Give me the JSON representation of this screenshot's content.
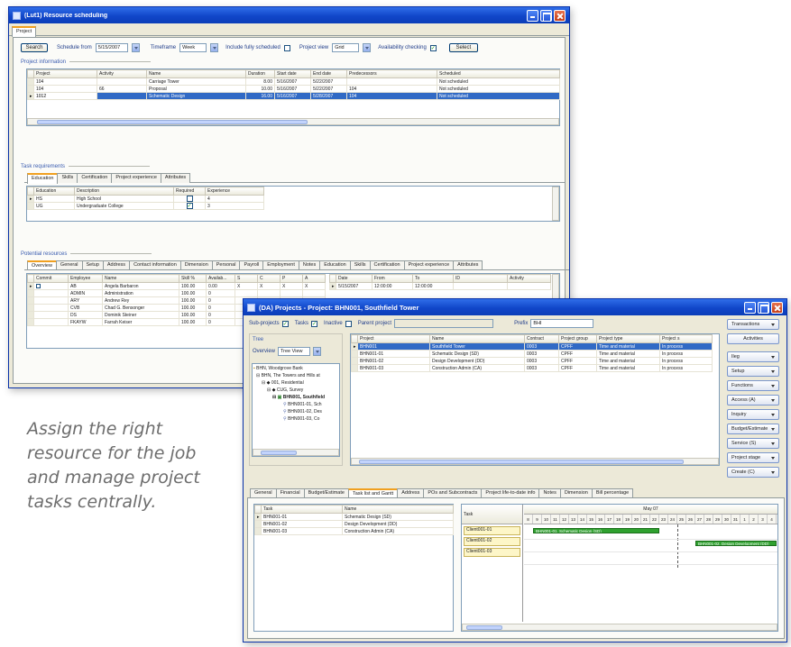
{
  "caption": {
    "line1": "Assign the right",
    "line2": "resource for the job",
    "line3": "and manage project",
    "line4": "tasks centrally."
  },
  "window1": {
    "title": "(Lut1) Resource scheduling",
    "main_tab": "Project",
    "toolbar": {
      "search_label": "Search",
      "schedule_from_label": "Schedule from",
      "schedule_from_value": "5/15/2007",
      "timeframe_label": "Timeframe",
      "timeframe_value": "Week",
      "include_label": "Include fully scheduled",
      "project_view_label": "Project view",
      "project_view_value": "Grid",
      "availability_label": "Availability checking",
      "select_label": "Select"
    },
    "project_group_title": "Project information",
    "project_table": {
      "headers": [
        "Project",
        "Activity",
        "Name",
        "Duration",
        "Start date",
        "End date",
        "Predecessors",
        "Scheduled"
      ],
      "rows": [
        [
          "104",
          "",
          "Carriage Tower",
          "8.00",
          "5/16/2007",
          "5/22/2007",
          "",
          "Not scheduled"
        ],
        [
          "104",
          "66",
          "Proposal",
          "10.00",
          "5/16/2007",
          "5/22/2007",
          "104",
          "Not scheduled"
        ],
        [
          "1012",
          "",
          "Schematic Design",
          "16.00",
          "5/16/2007",
          "5/28/2007",
          "104",
          "Not scheduled"
        ]
      ]
    },
    "task_group_title": "Task requirements",
    "task_tabs": [
      "Education",
      "Skills",
      "Certification",
      "Project experience",
      "Attributes"
    ],
    "education_table": {
      "headers": [
        "Education",
        "Description",
        "Required",
        "Experience"
      ],
      "rows": [
        [
          "HS",
          "High School",
          "",
          "4"
        ],
        [
          "UG",
          "Undergraduate College",
          "",
          "3"
        ]
      ]
    },
    "resources_group_title": "Potential resources",
    "resource_tabs": [
      "Overview",
      "General",
      "Setup",
      "Address",
      "Contact information",
      "Dimension",
      "Personal",
      "Payroll",
      "Employment",
      "Notes",
      "Education",
      "Skills",
      "Certification",
      "Project experience",
      "Attributes"
    ],
    "resource_table": {
      "headers": [
        "Commit",
        "Employee",
        "Name",
        "Skill %",
        "Availab...",
        "S",
        "C",
        "P",
        "A"
      ],
      "rows": [
        [
          "",
          "AB",
          "Angela Barbaron",
          "100.00",
          "0.00",
          "X",
          "X",
          "X",
          "X"
        ],
        [
          "",
          "ADMIN",
          "Administration",
          "100.00",
          "0",
          "",
          "",
          "",
          ""
        ],
        [
          "",
          "ARY",
          "Andrew Rey",
          "100.00",
          "0",
          "",
          "",
          "",
          ""
        ],
        [
          "",
          "CVB",
          "Chad G. Bensonger",
          "100.00",
          "0",
          "",
          "",
          "",
          ""
        ],
        [
          "",
          "DS",
          "Dominik Steiner",
          "100.00",
          "0",
          "",
          "",
          "",
          ""
        ],
        [
          "",
          "FKAYW",
          "Farrah Keiser",
          "100.00",
          "0",
          "",
          "",
          "",
          ""
        ]
      ]
    },
    "schedule_table": {
      "headers": [
        "Date",
        "From",
        "To",
        "ID",
        "Activity"
      ],
      "rows": [
        [
          "5/15/2007",
          "12:00:00",
          "12:00:00",
          "",
          ""
        ]
      ]
    }
  },
  "window2": {
    "title": "(DA) Projects - Project: BHN001, Southfield Tower",
    "filter": {
      "subprojects_label": "Sub-projects",
      "tasks_label": "Tasks",
      "inactive_label": "Inactive",
      "parent_label": "Parent project",
      "parent_value": "",
      "prefix_label": "Prefix",
      "prefix_value": "BHI"
    },
    "tree_header": "Tree",
    "overview_label": "Overview",
    "overview_value": "Tree View",
    "tree_items": [
      "BHN, Woodgrove Bank",
      "BHN, The Towers and Hills at",
      "001, Residential",
      "CUG, Survey",
      "BHN001, Southfield",
      "BHN001-01, Sch",
      "BHN001-02, Des",
      "BHN001-03, Co"
    ],
    "project_table": {
      "headers": [
        "Project",
        "Name",
        "Contract",
        "Project group",
        "Project type",
        "Project s"
      ],
      "rows": [
        [
          "BHN001",
          "Southfield Tower",
          "0003",
          "CPFF",
          "Time and material",
          "In process"
        ],
        [
          "BHN001-01",
          "Schematic Design (SD)",
          "0003",
          "CPFF",
          "Time and material",
          "In process"
        ],
        [
          "BHN001-02",
          "Design Development (DD)",
          "0003",
          "CPFF",
          "Time and material",
          "In process"
        ],
        [
          "BHN001-03",
          "Construction Admin (CA)",
          "0003",
          "CPFF",
          "Time and material",
          "In process"
        ]
      ]
    },
    "side_buttons": [
      "Transactions",
      "Activities",
      "Ileg",
      "Setup",
      "Functions",
      "Access (A)",
      "Inquiry",
      "Budget/Estimate",
      "Service (S)",
      "Project stage",
      "Create (C)"
    ],
    "detail_tabs": [
      "General",
      "Financial",
      "Budget/Estimate",
      "Task list and Gantt",
      "Address",
      "POs and Subcontracts",
      "Project life-to-date info",
      "Notes",
      "Dimension",
      "Bill percentage"
    ],
    "task_table": {
      "headers": [
        "Task",
        "Name"
      ],
      "rows": [
        [
          "BHN001-01",
          "Schematic Design (SD)"
        ],
        [
          "BHN001-02",
          "Design Development (DD)"
        ],
        [
          "BHN001-03",
          "Construction Admin (CA)"
        ]
      ]
    },
    "gantt": {
      "task_header": "Task",
      "month_label": "May 07",
      "days": [
        "8",
        "9",
        "10",
        "11",
        "12",
        "13",
        "14",
        "15",
        "16",
        "17",
        "18",
        "19",
        "20",
        "21",
        "22",
        "23",
        "24",
        "25",
        "26",
        "27",
        "28",
        "29",
        "30",
        "31",
        "1",
        "2",
        "3",
        "4"
      ],
      "rows": [
        "Client001-01",
        "Client001-02",
        "Client001-03"
      ],
      "bars": [
        {
          "row": 0,
          "start": 1,
          "span": 14,
          "label": "BHN001-01, Schematic Design (SD)"
        },
        {
          "row": 1,
          "start": 19,
          "span": 9,
          "label": "BHN001-02, Design Development (DD)"
        }
      ]
    }
  }
}
